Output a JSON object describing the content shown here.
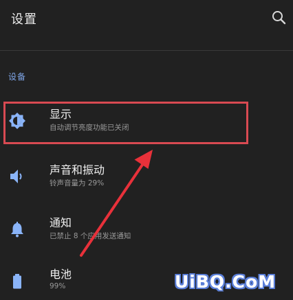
{
  "app_bar": {
    "title": "设置",
    "search_icon": "search-icon"
  },
  "section": {
    "header": "设备"
  },
  "items": [
    {
      "title": "显示",
      "subtitle": "自动调节亮度功能已关闭",
      "icon": "brightness-icon"
    },
    {
      "title": "声音和振动",
      "subtitle": "铃声音量为 29%",
      "icon": "volume-icon"
    },
    {
      "title": "通知",
      "subtitle": "已禁止 8 个应用发送通知",
      "icon": "bell-icon"
    },
    {
      "title": "电池",
      "subtitle": "99%",
      "icon": "battery-icon"
    }
  ],
  "annotation": {
    "highlight_color": "#d94a52",
    "arrow_color": "#e8313a"
  },
  "watermark": "UiBQ.CoM",
  "colors": {
    "background": "#212121",
    "accent": "#7fa6e8",
    "icon": "#8ab4f8"
  }
}
